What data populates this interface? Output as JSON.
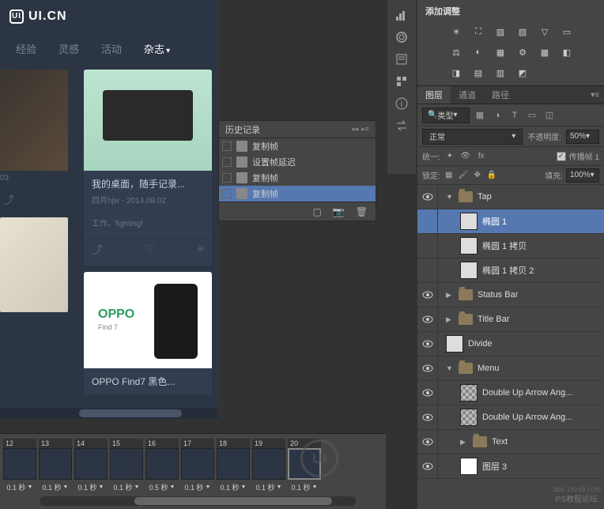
{
  "left": {
    "logo": "UI.CN",
    "nav": [
      "经验",
      "灵感",
      "活动",
      "杂志"
    ],
    "nav_active": "杂志",
    "card1": {
      "title": "我的桌面，随手记录...",
      "meta": "四月hjw - 2014.08.02",
      "status": "工作，fighting!"
    },
    "watch_meta": "03",
    "oppo": {
      "brand": "OPPO",
      "model": "Find 7",
      "title": "OPPO Find7 黑色..."
    }
  },
  "history": {
    "title": "历史记录",
    "items": [
      "复制帧",
      "设置帧延迟",
      "复制帧",
      "复制帧"
    ],
    "selected_index": 3
  },
  "adjustments": {
    "title": "添加调整"
  },
  "panels": {
    "tabs": [
      "图层",
      "通道",
      "路径"
    ],
    "active_tab": "图层",
    "filter_label": "类型",
    "blend_mode": "正常",
    "opacity_label": "不透明度:",
    "opacity_value": "50%",
    "unify_label": "统一:",
    "propagate_label": "传播帧 1",
    "lock_label": "锁定:",
    "fill_label": "填充:",
    "fill_value": "100%"
  },
  "layers": [
    {
      "name": "Tap",
      "type": "folder",
      "indent": 0,
      "vis": true,
      "open": true,
      "selected": false
    },
    {
      "name": "椭圆 1",
      "type": "shape",
      "indent": 1,
      "vis": false,
      "selected": true
    },
    {
      "name": "椭圆 1 拷贝",
      "type": "shape",
      "indent": 1,
      "vis": false,
      "selected": false
    },
    {
      "name": "椭圆 1 拷贝 2",
      "type": "shape",
      "indent": 1,
      "vis": false,
      "selected": false
    },
    {
      "name": "Status Bar",
      "type": "folder",
      "indent": 0,
      "vis": true,
      "open": false,
      "selected": false
    },
    {
      "name": "Title Bar",
      "type": "folder",
      "indent": 0,
      "vis": true,
      "open": false,
      "selected": false
    },
    {
      "name": "Divide",
      "type": "shape",
      "indent": 0,
      "vis": true,
      "selected": false
    },
    {
      "name": "Menu",
      "type": "folder",
      "indent": 0,
      "vis": true,
      "open": true,
      "selected": false
    },
    {
      "name": "Double Up Arrow Ang...",
      "type": "checker",
      "indent": 1,
      "vis": true,
      "selected": false
    },
    {
      "name": "Double Up Arrow Ang...",
      "type": "checker",
      "indent": 1,
      "vis": true,
      "selected": false
    },
    {
      "name": "Text",
      "type": "folder",
      "indent": 1,
      "vis": true,
      "open": false,
      "selected": false
    },
    {
      "name": "图层 3",
      "type": "white",
      "indent": 1,
      "vis": true,
      "selected": false
    }
  ],
  "timeline": {
    "frames": [
      {
        "num": "12",
        "dur": "0.1 秒"
      },
      {
        "num": "13",
        "dur": "0.1 秒"
      },
      {
        "num": "14",
        "dur": "0.1 秒"
      },
      {
        "num": "15",
        "dur": "0.1 秒"
      },
      {
        "num": "16",
        "dur": "0.5 秒"
      },
      {
        "num": "17",
        "dur": "0.1 秒"
      },
      {
        "num": "18",
        "dur": "0.1 秒"
      },
      {
        "num": "19",
        "dur": "0.1 秒"
      },
      {
        "num": "20",
        "dur": "0.1 秒"
      }
    ],
    "selected_index": 8
  },
  "watermark": "PS教程论坛",
  "watermark2": "bbs.16xx8.com"
}
